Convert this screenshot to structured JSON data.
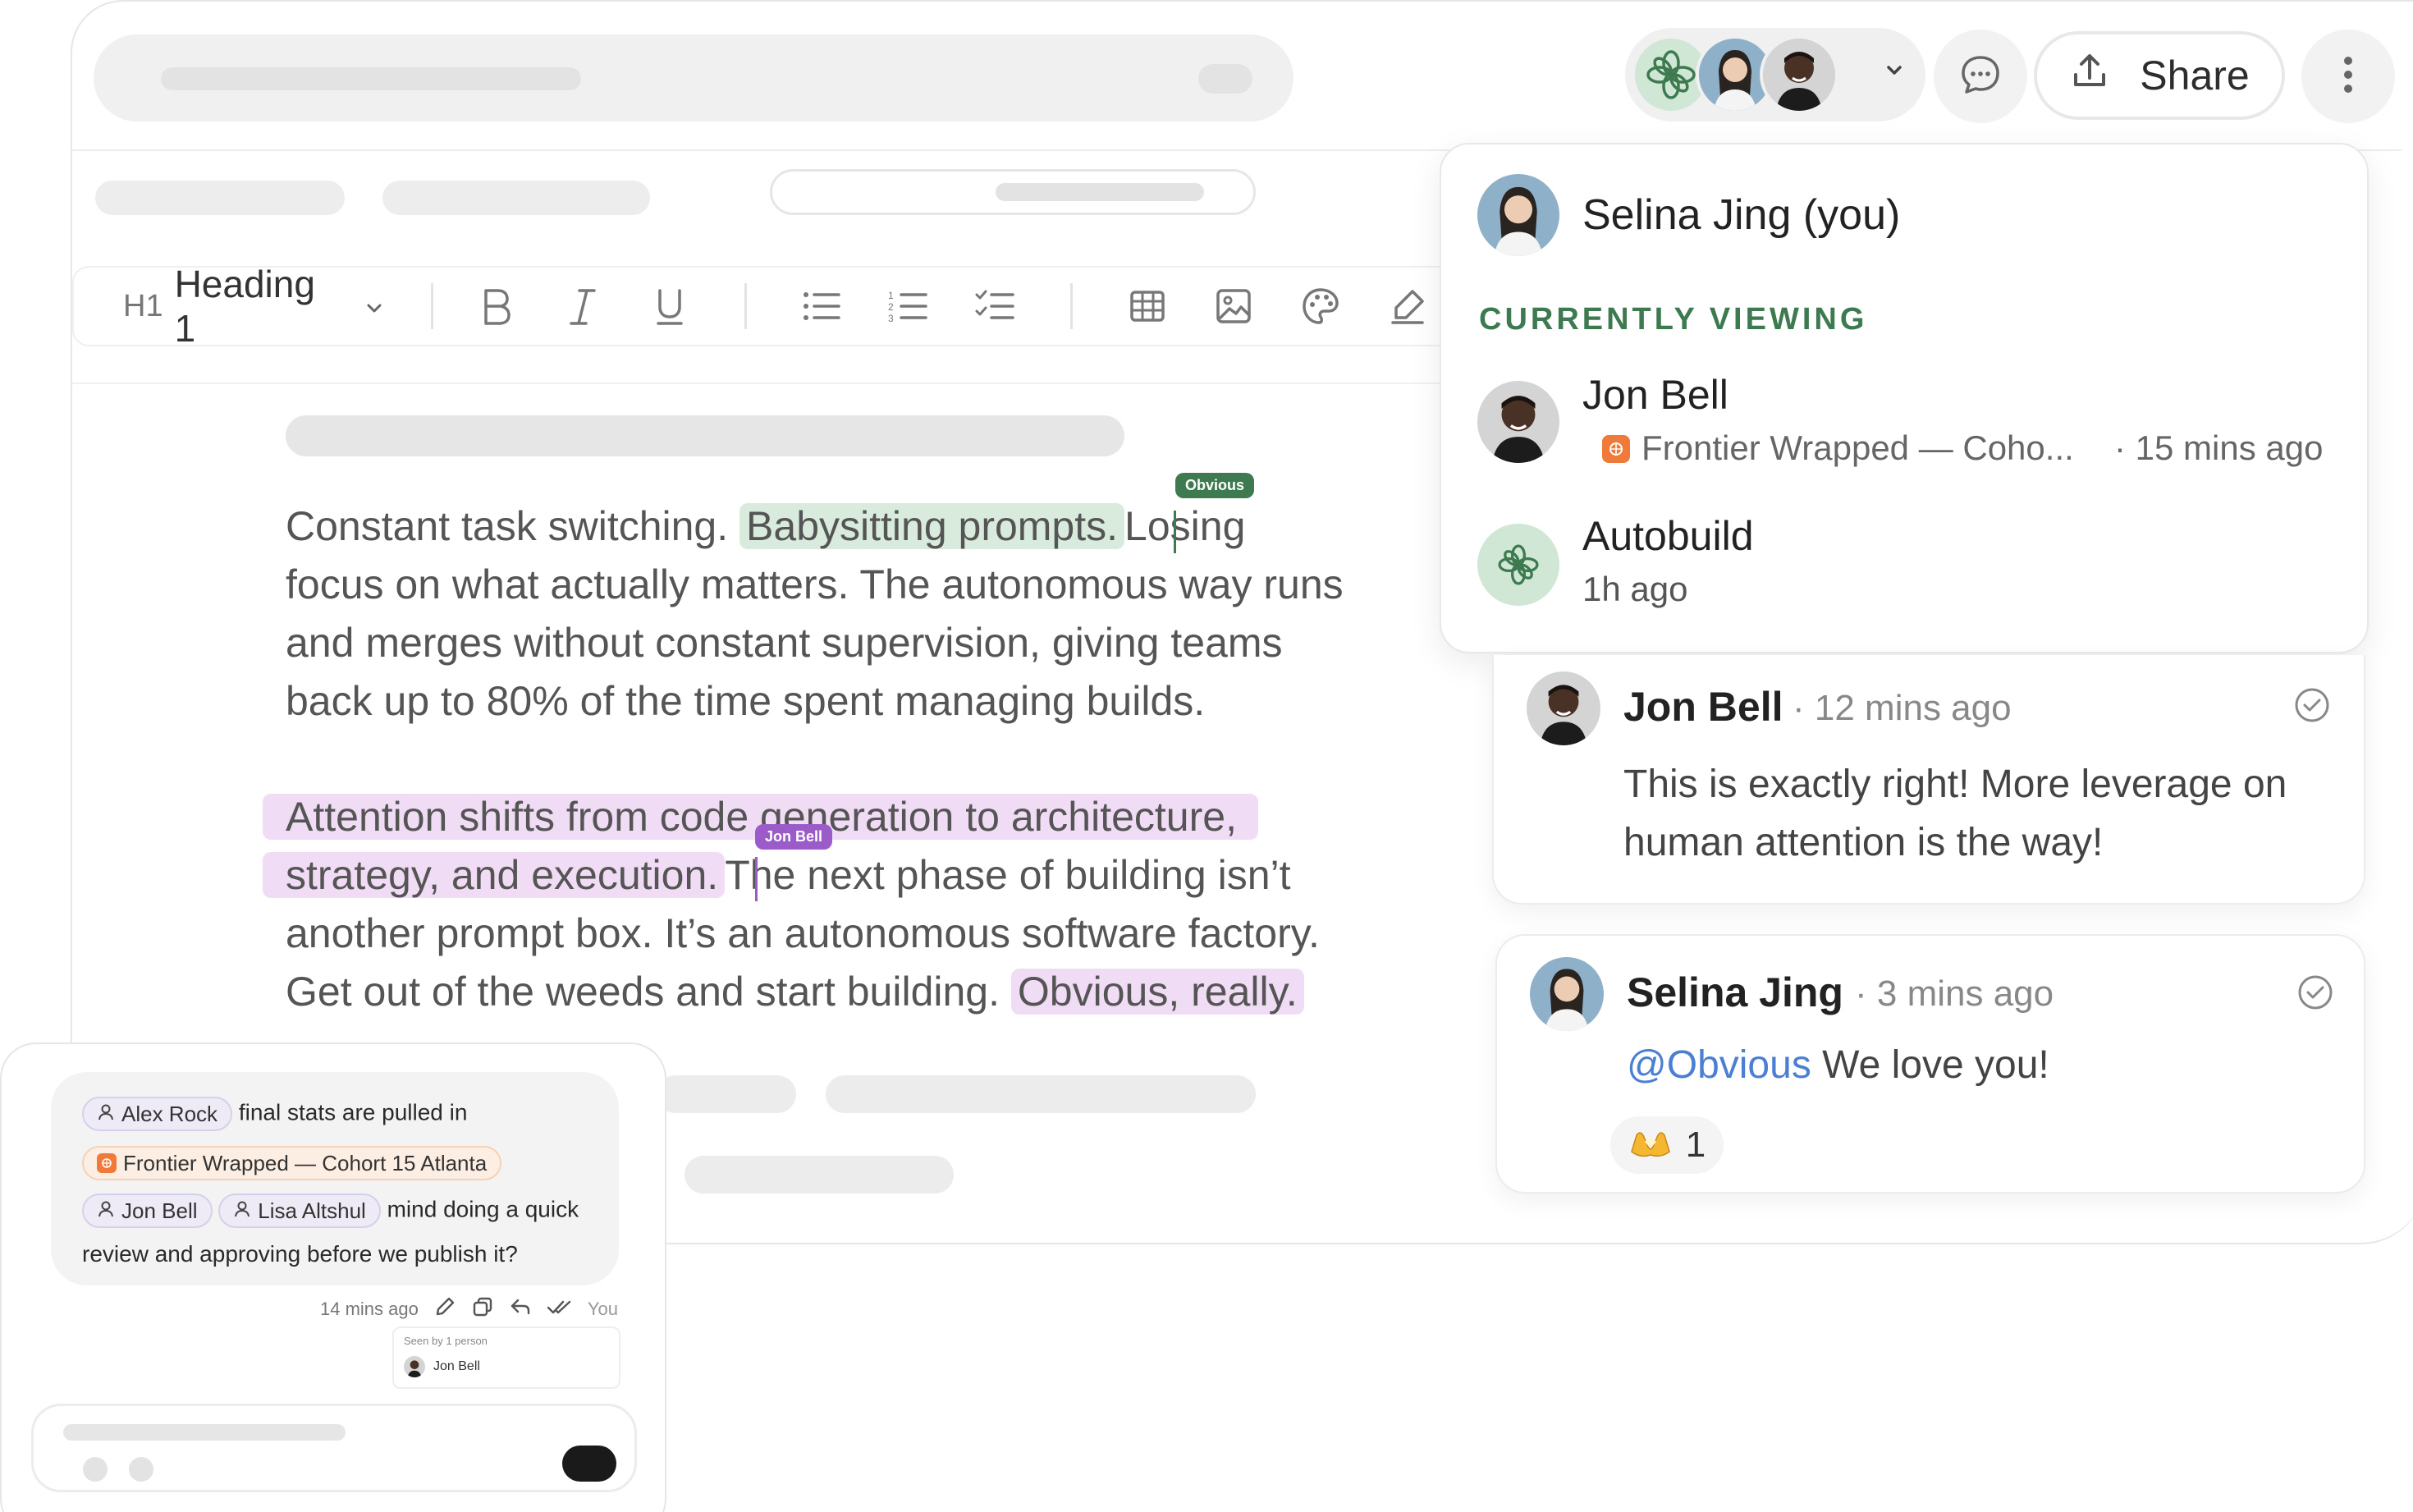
{
  "header": {
    "share_label": "Share"
  },
  "toolbar": {
    "heading_prefix": "H1",
    "heading_label": "Heading 1"
  },
  "document": {
    "para1": {
      "before": "Constant task switching.",
      "highlight": "Babysitting prompts.",
      "after_line1": "Losing",
      "line2": "focus on what actually matters. The autonomous way runs",
      "line3": "and merges without constant supervision, giving teams",
      "line4": "back up to 80% of the time spent managing builds."
    },
    "para2": {
      "highlight_line1": "Attention shifts from code generation to architecture,",
      "highlight_line2": "strategy, and execution.",
      "after_line2": "The next phase of building isn’t",
      "line3": "another prompt box. It’s an autonomous software factory.",
      "line4_before": "Get out of the weeds and start building.",
      "line4_highlight": "Obvious, really."
    },
    "cursor_obvious": "Obvious",
    "cursor_jon": "Jon Bell"
  },
  "viewers": {
    "self_name": "Selina Jing (you)",
    "section_label": "CURRENTLY VIEWING",
    "items": [
      {
        "name": "Jon Bell",
        "doc": "Frontier Wrapped — Coho...",
        "time": "· 15 mins ago"
      },
      {
        "name": "Autobuild",
        "time": "1h ago"
      }
    ]
  },
  "comments": [
    {
      "author": "Jon Bell",
      "time": "· 12 mins ago",
      "line1": "This is exactly right! More leverage on",
      "line2": "human attention is the way!"
    },
    {
      "author": "Selina Jing",
      "time": "· 3 mins ago",
      "mention": "@Obvious",
      "text": "We love you!",
      "reaction_count": "1"
    }
  ],
  "chat": {
    "chip_alex": "Alex Rock",
    "text1": "final stats are pulled in",
    "chip_project": "Frontier Wrapped — Cohort 15 Atlanta",
    "chip_jon": "Jon Bell",
    "chip_lisa": "Lisa Altshul",
    "text2": "mind doing a quick",
    "text3": "review and approving before we publish it?",
    "meta_time": "14 mins ago",
    "meta_you": "You",
    "seen_label": "Seen by 1 person",
    "seen_name": "Jon Bell"
  },
  "colors": {
    "accent_green": "#3d7a4f",
    "highlight_green": "#d9ebdd",
    "highlight_purple": "#f1dcf6",
    "cursor_purple": "#9b5bc9",
    "mention_blue": "#4a7fd4"
  }
}
